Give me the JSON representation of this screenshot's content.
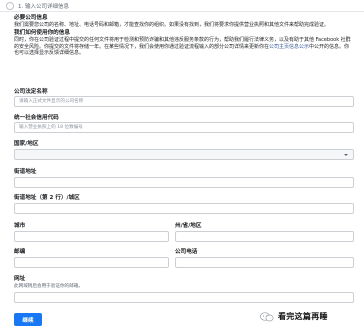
{
  "step": {
    "label": "1. 输入公司详细信息"
  },
  "intro": {
    "h1": "必要公司信息",
    "p1": "我们需要您公司的名称、地址、电话号码和邮箱，才能查找你的组织。如果没有找到，我们将要求你提供营业执照和其他文件来帮助完成验证。",
    "h2": "我们如何使用你的信息",
    "p2_before": "同时，你在公司验证过程中提交的任何文件将用于检测和预防诈骗和其他违反服务条款的行为，帮助我们履行法律义务，以及有助于其他 Facebook 社群的安全风险。你提交的文件将存储一年。在某些情况下，我们会使用你通过验证流程输入的部分公司详情来更新你在",
    "p2_link": "公司主页信息公示",
    "p2_after": "中公开的信息。你也可以选择显示反馈详细信息。"
  },
  "form": {
    "company_name": {
      "label": "公司法定名称",
      "placeholder": "请输入正式文件显示的公司名称"
    },
    "credit_code": {
      "label": "统一社会信用代码",
      "placeholder": "输入营业执照上的 18 位数编号"
    },
    "country": {
      "label": "国家/地区",
      "value": ""
    },
    "street1": {
      "label": "街道地址",
      "value": ""
    },
    "street2": {
      "label": "街道地址（第 2 行）/城区",
      "value": ""
    },
    "city": {
      "label": "城市",
      "value": ""
    },
    "state": {
      "label": "州/省/地区",
      "value": ""
    },
    "zip": {
      "label": "邮编",
      "value": ""
    },
    "phone": {
      "label": "公司电话",
      "value": ""
    },
    "website": {
      "label": "网址",
      "hint": "此网域稍后会用于验证你的邮箱。",
      "value": ""
    }
  },
  "button": {
    "label": "继续"
  },
  "watermark": {
    "text": "看完这篇再睡"
  }
}
